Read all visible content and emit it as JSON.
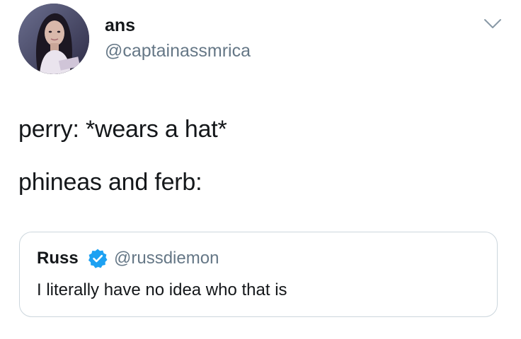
{
  "tweet": {
    "author": {
      "display_name": "ans",
      "handle": "@captainassmrica",
      "avatar_icon": "profile-photo"
    },
    "menu_icon": "chevron-down-icon",
    "body_lines": [
      "perry: *wears a hat*",
      "phineas and ferb:"
    ],
    "quoted_tweet": {
      "display_name": "Russ",
      "verified_icon": "verified-badge-icon",
      "handle": "@russdiemon",
      "text": "I literally have no idea who that is"
    }
  },
  "colors": {
    "text_primary": "#14171a",
    "text_secondary": "#657786",
    "border": "#ccd6dd",
    "verified": "#1da1f2"
  }
}
